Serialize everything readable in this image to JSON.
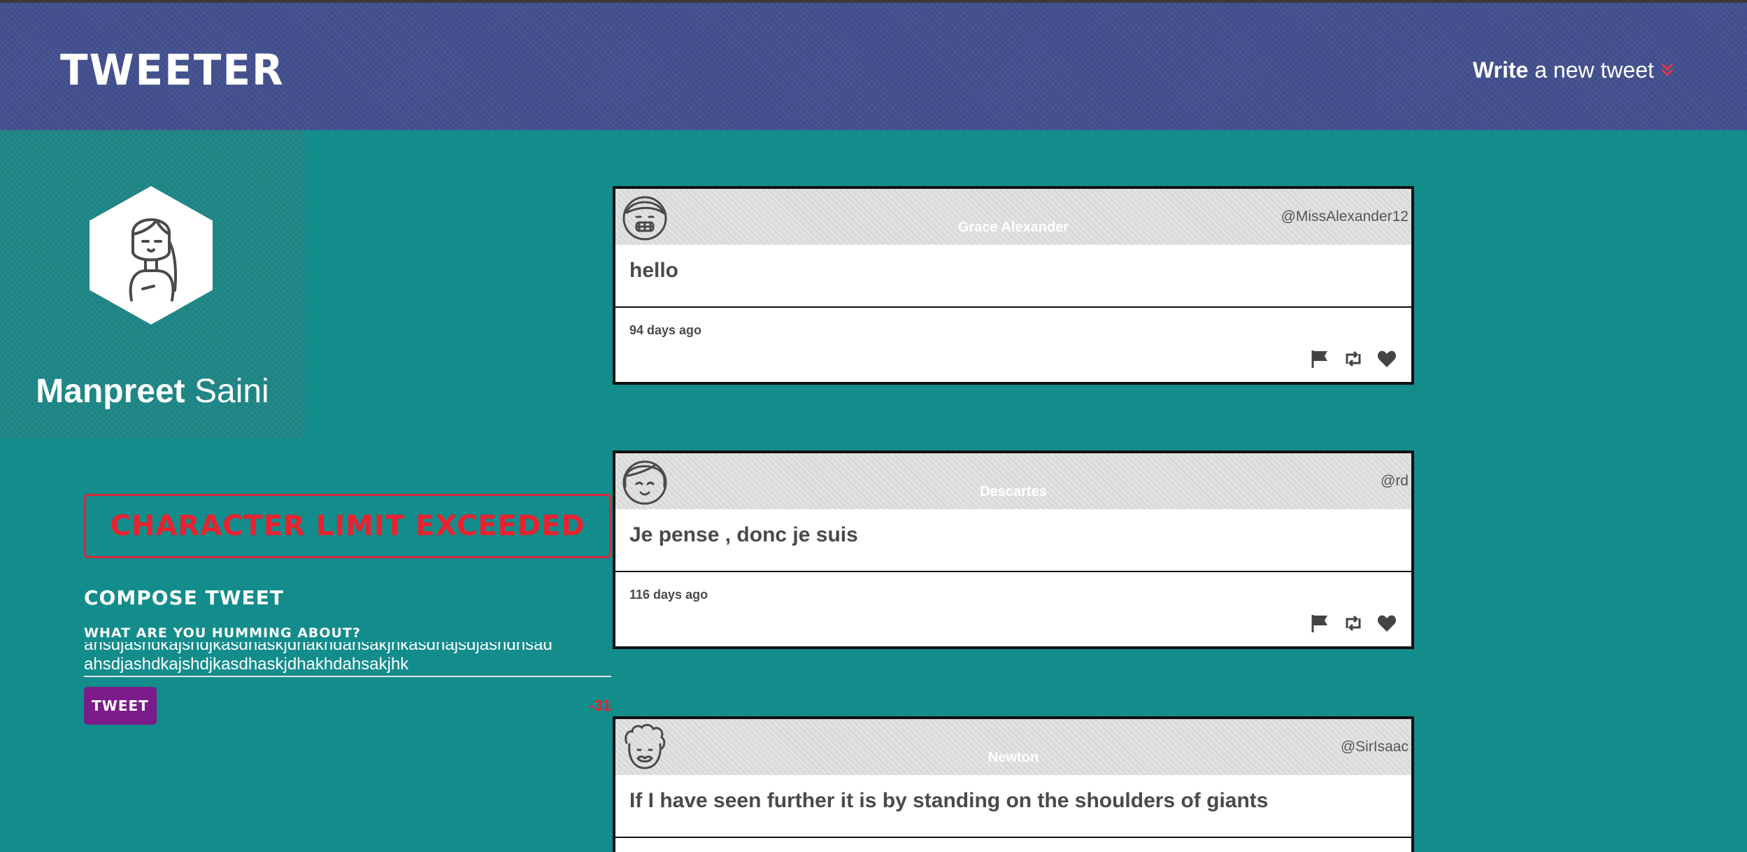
{
  "nav": {
    "brand": "TWEETER",
    "write_bold": "Write",
    "write_rest": "a new tweet",
    "chevron_icon": "double-chevron-down-icon"
  },
  "profile": {
    "first_name": "Manpreet",
    "last_name": "Saini",
    "avatar_icon": "girl-avatar-icon"
  },
  "compose": {
    "error": "Character limit exceeded",
    "title": "Compose Tweet",
    "label": "What are you humming about?",
    "text_line1": "ahsdjashdkajshdjkasdhaskjdhakhdahsakjhkasdhajsdjashdhsad",
    "text_line2": "ahsdjashdkajshdjkasdhaskjdhakhdahsakjhk",
    "button": "Tweet",
    "counter": "-31"
  },
  "tweets": [
    {
      "name": "Grace Alexander",
      "handle": "@MissAlexander12",
      "content": "hello",
      "age": "94 days ago"
    },
    {
      "name": "Descartes",
      "handle": "@rd",
      "content": "Je pense , donc je suis",
      "age": "116 days ago"
    },
    {
      "name": "Newton",
      "handle": "@SirIsaac",
      "content": "If I have seen further it is by standing on the shoulders of giants",
      "age": ""
    }
  ],
  "colors": {
    "navbar": "#43508f",
    "background": "#138c8c",
    "error": "#e8222f",
    "button": "#7c1c8a"
  }
}
